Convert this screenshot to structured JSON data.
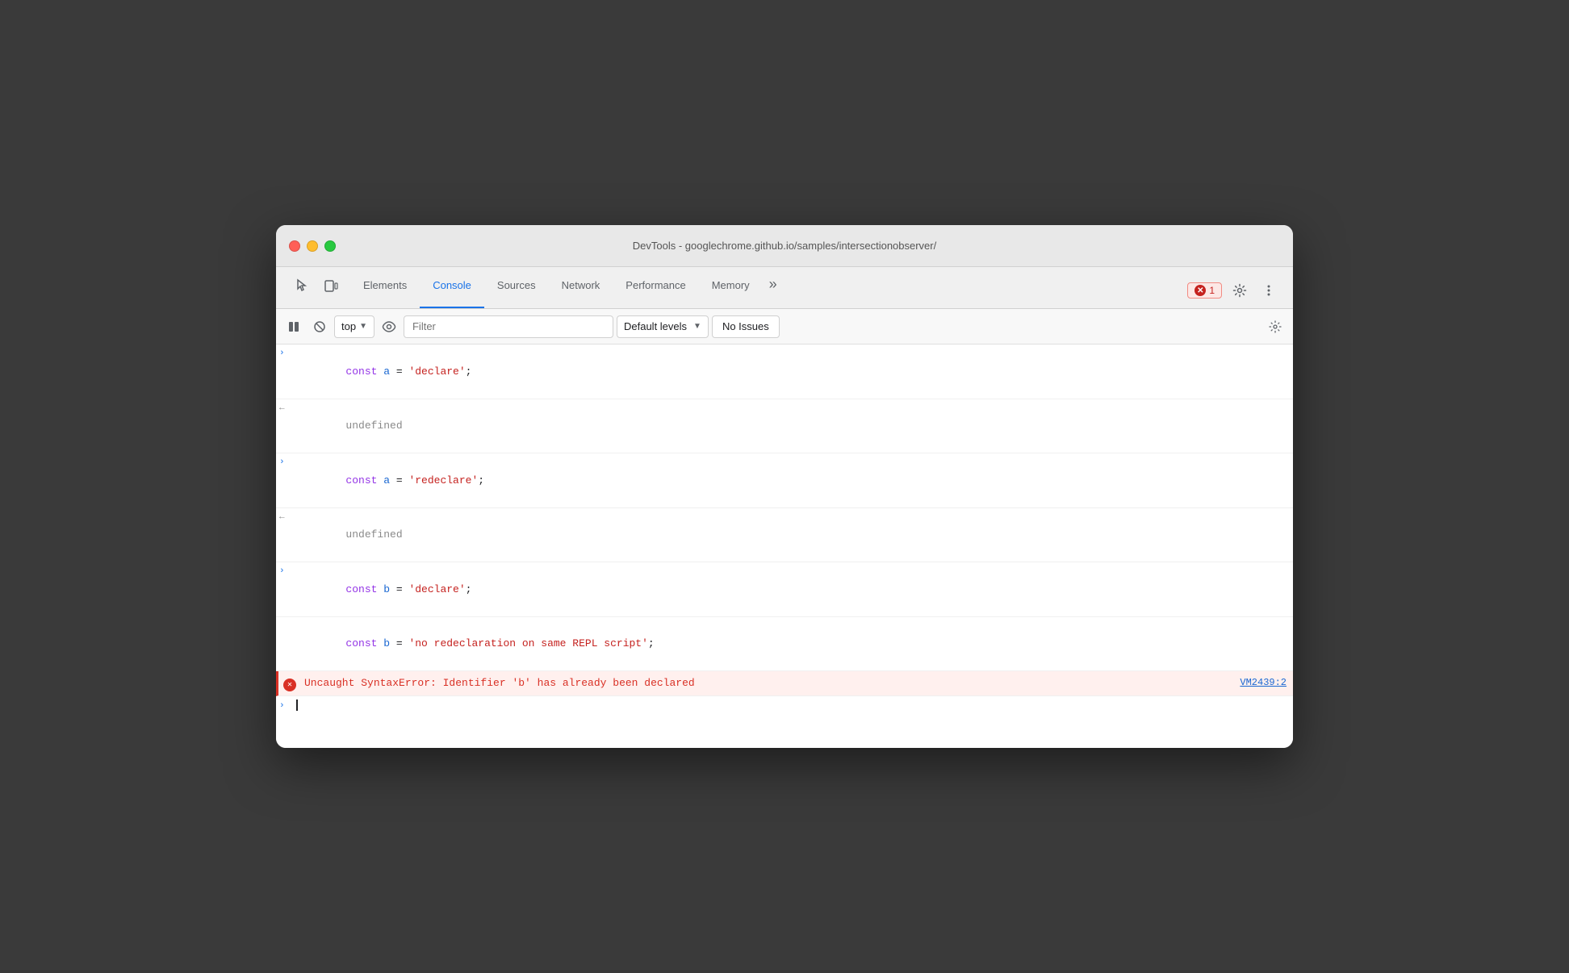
{
  "titlebar": {
    "title": "DevTools - googlechrome.github.io/samples/intersectionobserver/"
  },
  "tabs": {
    "items": [
      {
        "id": "elements",
        "label": "Elements",
        "active": false
      },
      {
        "id": "console",
        "label": "Console",
        "active": true
      },
      {
        "id": "sources",
        "label": "Sources",
        "active": false
      },
      {
        "id": "network",
        "label": "Network",
        "active": false
      },
      {
        "id": "performance",
        "label": "Performance",
        "active": false
      },
      {
        "id": "memory",
        "label": "Memory",
        "active": false
      }
    ],
    "more_label": "»",
    "error_count": "1",
    "settings_label": "⚙",
    "more_options_label": "⋮"
  },
  "console_toolbar": {
    "top_label": "top",
    "filter_placeholder": "Filter",
    "default_levels_label": "Default levels",
    "no_issues_label": "No Issues",
    "settings_label": "⚙"
  },
  "console_lines": [
    {
      "type": "input",
      "arrow": "›",
      "content_parts": [
        {
          "type": "kw",
          "text": "const "
        },
        {
          "type": "var",
          "text": "a"
        },
        {
          "type": "punct",
          "text": " = "
        },
        {
          "type": "str",
          "text": "'declare'"
        },
        {
          "type": "punct",
          "text": ";"
        }
      ],
      "source": null
    },
    {
      "type": "output",
      "arrow": "←",
      "content_parts": [
        {
          "type": "undef",
          "text": "undefined"
        }
      ],
      "source": null
    },
    {
      "type": "input",
      "arrow": "›",
      "content_parts": [
        {
          "type": "kw",
          "text": "const "
        },
        {
          "type": "var",
          "text": "a"
        },
        {
          "type": "punct",
          "text": " = "
        },
        {
          "type": "str",
          "text": "'redeclare'"
        },
        {
          "type": "punct",
          "text": ";"
        }
      ],
      "source": null
    },
    {
      "type": "output",
      "arrow": "←",
      "content_parts": [
        {
          "type": "undef",
          "text": "undefined"
        }
      ],
      "source": null
    },
    {
      "type": "input",
      "arrow": "›",
      "content_parts": [
        {
          "type": "kw",
          "text": "const "
        },
        {
          "type": "var",
          "text": "b"
        },
        {
          "type": "punct",
          "text": " = "
        },
        {
          "type": "str",
          "text": "'declare'"
        },
        {
          "type": "punct",
          "text": ";"
        }
      ],
      "source": null
    },
    {
      "type": "input-continued",
      "arrow": "",
      "content_parts": [
        {
          "type": "kw",
          "text": "const "
        },
        {
          "type": "var",
          "text": "b"
        },
        {
          "type": "punct",
          "text": " = "
        },
        {
          "type": "str",
          "text": "'no redeclaration on same REPL script'"
        },
        {
          "type": "punct",
          "text": ";"
        }
      ],
      "source": null
    },
    {
      "type": "error",
      "arrow": "",
      "content_parts": [
        {
          "type": "err",
          "text": "Uncaught SyntaxError: Identifier 'b' has already been declared"
        }
      ],
      "source": "VM2439:2"
    }
  ],
  "cursor_line": {
    "arrow": "›"
  },
  "colors": {
    "accent_blue": "#1a73e8",
    "error_red": "#d93025",
    "error_bg": "#fff0ee"
  }
}
